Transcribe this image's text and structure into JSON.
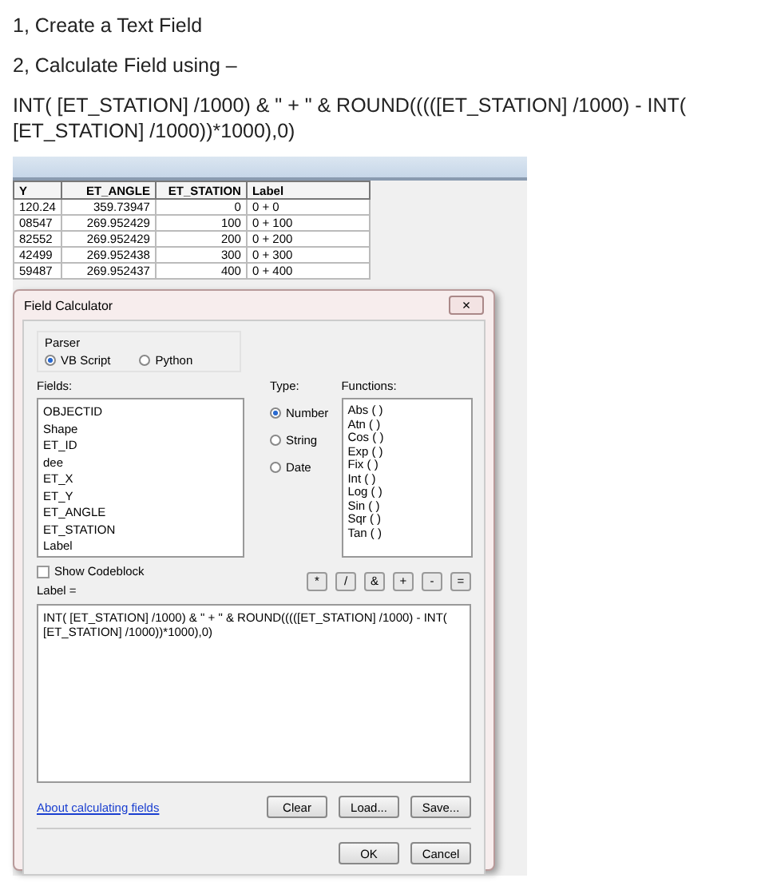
{
  "document": {
    "paragraphs": [
      "1, Create a Text Field",
      "2, Calculate Field using –",
      "INT( [ET_STATION] /1000) & \" + \" & ROUND(((([ET_STATION] /1000) - INT( [ET_STATION] /1000))*1000),0)"
    ]
  },
  "table": {
    "columns": [
      "Y",
      "ET_ANGLE",
      "ET_STATION",
      "Label"
    ],
    "rows": [
      [
        "120.24",
        "359.73947",
        "0",
        "0 + 0"
      ],
      [
        "08547",
        "269.952429",
        "100",
        "0 + 100"
      ],
      [
        "82552",
        "269.952429",
        "200",
        "0 + 200"
      ],
      [
        "42499",
        "269.952438",
        "300",
        "0 + 300"
      ],
      [
        "59487",
        "269.952437",
        "400",
        "0 + 400"
      ]
    ]
  },
  "dialog": {
    "title": "Field Calculator",
    "close": "×",
    "parser": {
      "label": "Parser",
      "options": [
        {
          "label": "VB Script",
          "selected": true
        },
        {
          "label": "Python",
          "selected": false
        }
      ]
    },
    "fields": {
      "label": "Fields:",
      "items": [
        "OBJECTID",
        "Shape",
        "ET_ID",
        "dee",
        "ET_X",
        "ET_Y",
        "ET_ANGLE",
        "ET_STATION",
        "Label"
      ]
    },
    "type": {
      "label": "Type:",
      "options": [
        {
          "label": "Number",
          "selected": true
        },
        {
          "label": "String",
          "selected": false
        },
        {
          "label": "Date",
          "selected": false
        }
      ]
    },
    "functions": {
      "label": "Functions:",
      "items": [
        "Abs ( )",
        "Atn ( )",
        "Cos ( )",
        "Exp ( )",
        "Fix ( )",
        "Int ( )",
        "Log ( )",
        "Sin ( )",
        "Sqr ( )",
        "Tan ( )"
      ]
    },
    "show_codeblock": {
      "label": "Show Codeblock",
      "checked": false
    },
    "operators": [
      "*",
      "/",
      "&",
      "+",
      "-",
      "="
    ],
    "expression_label": "Label =",
    "expression": "INT( [ET_STATION] /1000) & \" + \" & ROUND(((([ET_STATION] /1000) - INT( [ET_STATION] /1000))*1000),0)",
    "link": "About calculating fields",
    "file_buttons": [
      "Clear",
      "Load...",
      "Save..."
    ],
    "buttons": [
      "OK",
      "Cancel"
    ]
  }
}
